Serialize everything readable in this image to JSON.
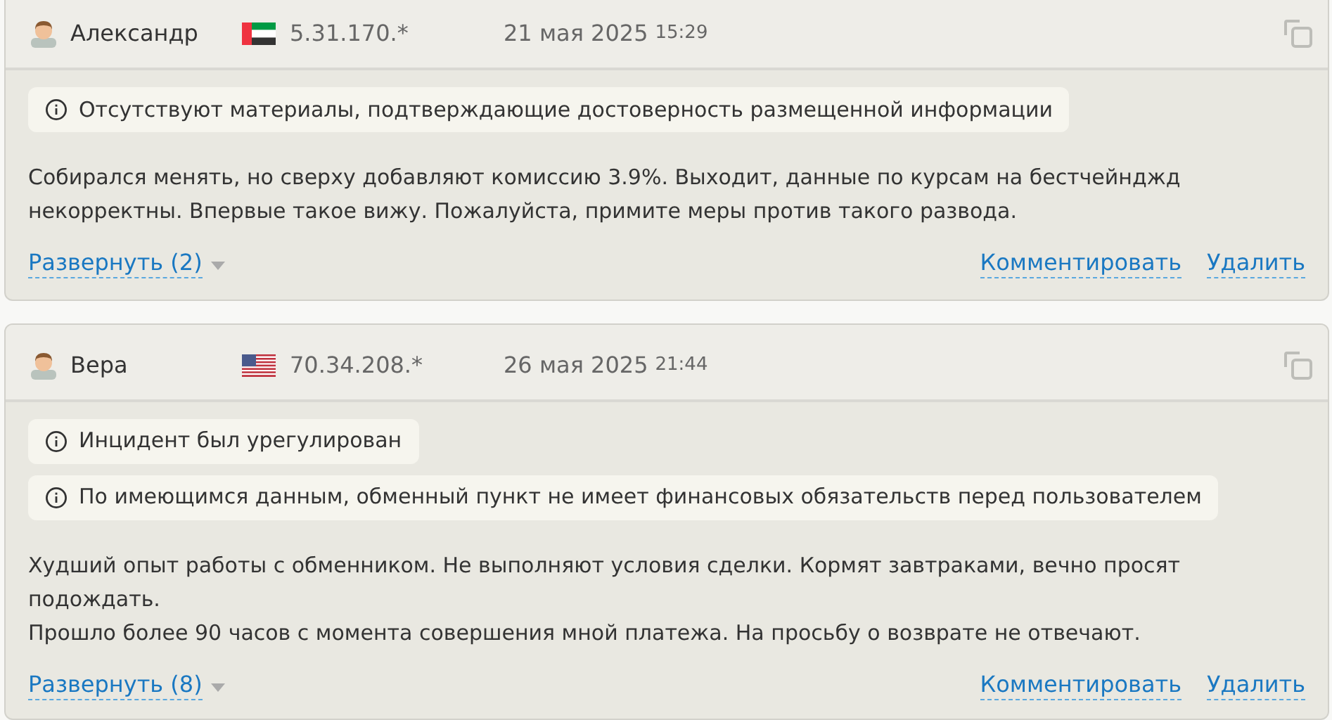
{
  "reviews": [
    {
      "author": "Александр",
      "flag": {
        "kind": "ae"
      },
      "ip": "5.31.170.*",
      "date": "21 мая 2025",
      "time": "15:29",
      "notices": [
        "Отсутствуют материалы, подтверждающие достоверность размещенной информации"
      ],
      "paragraphs": [
        "Собирался менять, но сверху добавляют комиссию 3.9%. Выходит, данные по курсам на бестчейнджд некорректны. Впервые такое вижу. Пожалуйста, примите меры против такого развода."
      ],
      "expand": "Развернуть (2)",
      "actions": [
        "Комментировать",
        "Удалить"
      ]
    },
    {
      "author": "Вера",
      "flag": {
        "kind": "us"
      },
      "ip": "70.34.208.*",
      "date": "26 мая 2025",
      "time": "21:44",
      "notices": [
        "Инцидент был урегулирован",
        "По имеющимся данным, обменный пункт не имеет финансовых обязательств перед пользователем"
      ],
      "paragraphs": [
        "Худший опыт работы с обменником. Не выполняют условия сделки. Кормят завтраками, вечно просят подождать.",
        "Прошло более 90 часов с момента совершения мной платежа. На просьбу о возврате не отвечают."
      ],
      "expand": "Развернуть (8)",
      "actions": [
        "Комментировать",
        "Удалить"
      ]
    }
  ]
}
